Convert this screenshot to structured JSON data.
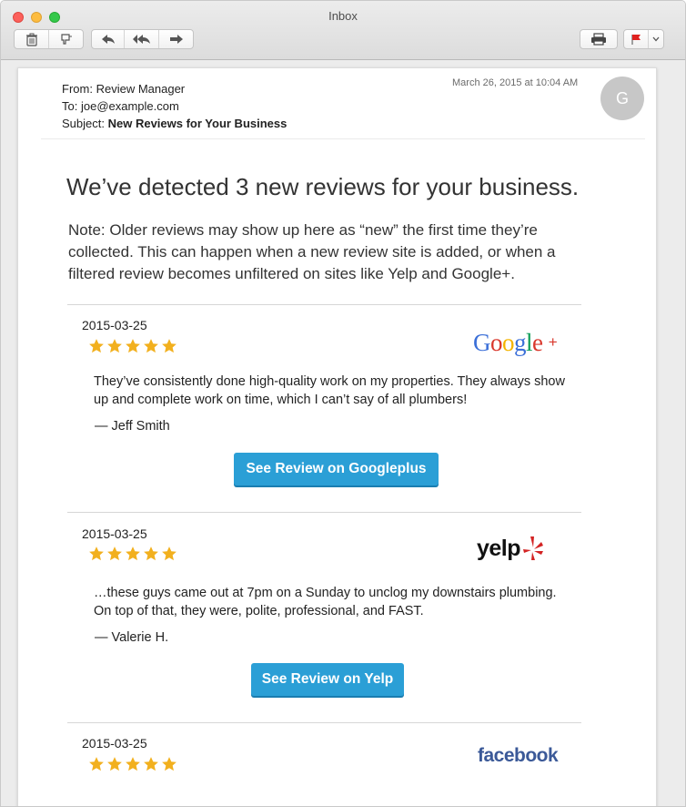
{
  "window": {
    "title": "Inbox"
  },
  "toolbar": {
    "icons": [
      "trash-icon",
      "junk-icon",
      "reply-icon",
      "reply-all-icon",
      "forward-icon",
      "print-icon",
      "flag-icon",
      "chevron-down-icon"
    ],
    "flag_color": "#e0211f"
  },
  "message": {
    "from_label": "From:",
    "from_value": "Review Manager",
    "to_label": "To:",
    "to_value": "joe@example.com",
    "subject_label": "Subject:",
    "subject_value": "New Reviews for Your Business",
    "date": "March 26, 2015 at 10:04 AM",
    "avatar_initial": "G",
    "headline": "We’ve detected 3 new reviews for your business.",
    "note": "Note: Older reviews may show up here as “new” the first time they’re collected. This can happen when a new review site is added, or when a filtered review becomes unfiltered on sites like Yelp and Google+."
  },
  "reviews": [
    {
      "date": "2015-03-25",
      "rating": 5,
      "site": "Google+",
      "logo_text": "Google",
      "logo_suffix": "+",
      "text": "They’ve consistently done high-quality work on my properties. They always show up and complete work on time, which I can’t say of all plumbers!",
      "author": "— Jeff Smith",
      "button": "See Review on Googleplus"
    },
    {
      "date": "2015-03-25",
      "rating": 5,
      "site": "Yelp",
      "logo_text": "yelp",
      "text": "…these guys came out at 7pm on a Sunday to unclog my downstairs plumbing. On top of that, they were, polite, professional, and FAST.",
      "author": "— Valerie H.",
      "button": "See Review on Yelp"
    },
    {
      "date": "2015-03-25",
      "rating": 5,
      "site": "Facebook",
      "logo_text": "facebook"
    }
  ],
  "colors": {
    "button": "#2b9fd6",
    "star": "#f2b01e",
    "facebook": "#3b5998",
    "yelp_burst": "#d32323"
  }
}
